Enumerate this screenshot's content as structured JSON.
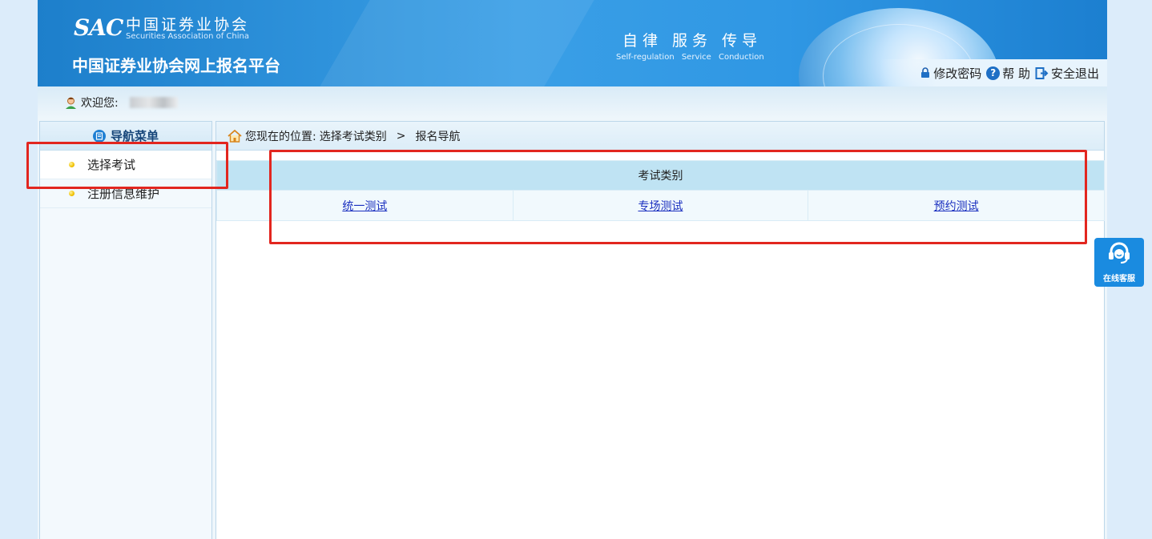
{
  "header": {
    "logo_abbr": "SAC",
    "logo_cn": "中国证券业协会",
    "logo_en": "Securities Association of China",
    "site_title": "中国证券业协会网上报名平台",
    "motto_cn": "自律 服务 传导",
    "motto_en": "Self-regulation Service Conduction",
    "links": {
      "change_password": "修改密码",
      "help": "帮 助",
      "logout": "安全退出"
    }
  },
  "welcome": {
    "label": "欢迎您:"
  },
  "sidebar": {
    "title": "导航菜单",
    "items": [
      {
        "label": "选择考试",
        "active": true
      },
      {
        "label": "注册信息维护",
        "active": false
      }
    ]
  },
  "main": {
    "breadcrumb": {
      "prefix": "您现在的位置:",
      "path1": "选择考试类别",
      "separator": ">",
      "path2": "报名导航"
    },
    "table": {
      "header": "考试类别",
      "links": [
        "统一测试",
        "专场测试",
        "预约测试"
      ]
    }
  },
  "service": {
    "label": "在线客服"
  },
  "colors": {
    "header_blue": "#2f97e4",
    "highlight_red": "#e2261f",
    "link_blue": "#1a2fbf",
    "table_header": "#bfe3f3"
  }
}
